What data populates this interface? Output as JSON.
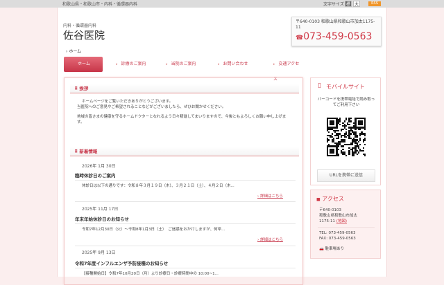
{
  "topbar": {
    "breadcrumb": "和歌山県・和歌山市・内科・循環器内科",
    "font_size_label": "文字サイズ",
    "font_normal": "標",
    "font_large": "大",
    "rss": "RSS"
  },
  "header": {
    "subtitle": "内科・循環器内科",
    "title": "佐谷医院",
    "address": "〒640-0103 和歌山県和歌山市加太1175-11",
    "tel": "073-459-0563"
  },
  "breadcrumb": "ホーム",
  "nav": [
    {
      "label": "ホーム"
    },
    {
      "label": "診療のご案内"
    },
    {
      "label": "当院のご案内"
    },
    {
      "label": "お問い合わせ"
    },
    {
      "label": "交通アクセス"
    }
  ],
  "greeting": {
    "heading": "挨拶",
    "p1": "ホームページをご覧いただきありがとうございます。",
    "p2": "当医院へのご意見やご希望されることなどがございましたら、ぜひお聞かせください。",
    "p3": "地域の皆さまの健康を守るホームドクターとなれるよう日々精進してまいりますので、今後ともよろしくお願い申し上げます。"
  },
  "news": {
    "heading": "新着情報",
    "more_label": "詳細はこちら",
    "items": [
      {
        "date": "2026年 1月 30日",
        "title": "臨時休診日のご案内",
        "excerpt": "休診日は以下の通りです：令和８年３月１９日（木）、３月２１日（土）、４月２日（木..."
      },
      {
        "date": "2025年 11月 17日",
        "title": "年末年始休診日のお知らせ",
        "excerpt": "令和7年12月30日（火）～令和8年1月3日（土）　ご迷惑をおかけしますが、何卒..."
      },
      {
        "date": "2025年 9月 13日",
        "title": "令和7年度インフルエンザ予防接種のお知らせ",
        "excerpt": "【接種開始日】令和7年10月20日（月）より診療日・診療時間中の 10:00~1..."
      }
    ]
  },
  "mobile": {
    "heading": "モバイルサイト",
    "desc": "バーコードを携帯電話で読み取ってご利用下さい",
    "button": "URLを携帯に送信"
  },
  "access": {
    "heading": "アクセス",
    "postal": "〒640-0103",
    "addr1": "和歌山県和歌山市加太",
    "addr2": "1175-11",
    "map_link": "(地図)",
    "tel": "TEL: 073-459-0563",
    "fax": "FAX: 073-459-0563",
    "parking": "駐車場あり"
  },
  "colors": {
    "accent": "#d03a48"
  }
}
